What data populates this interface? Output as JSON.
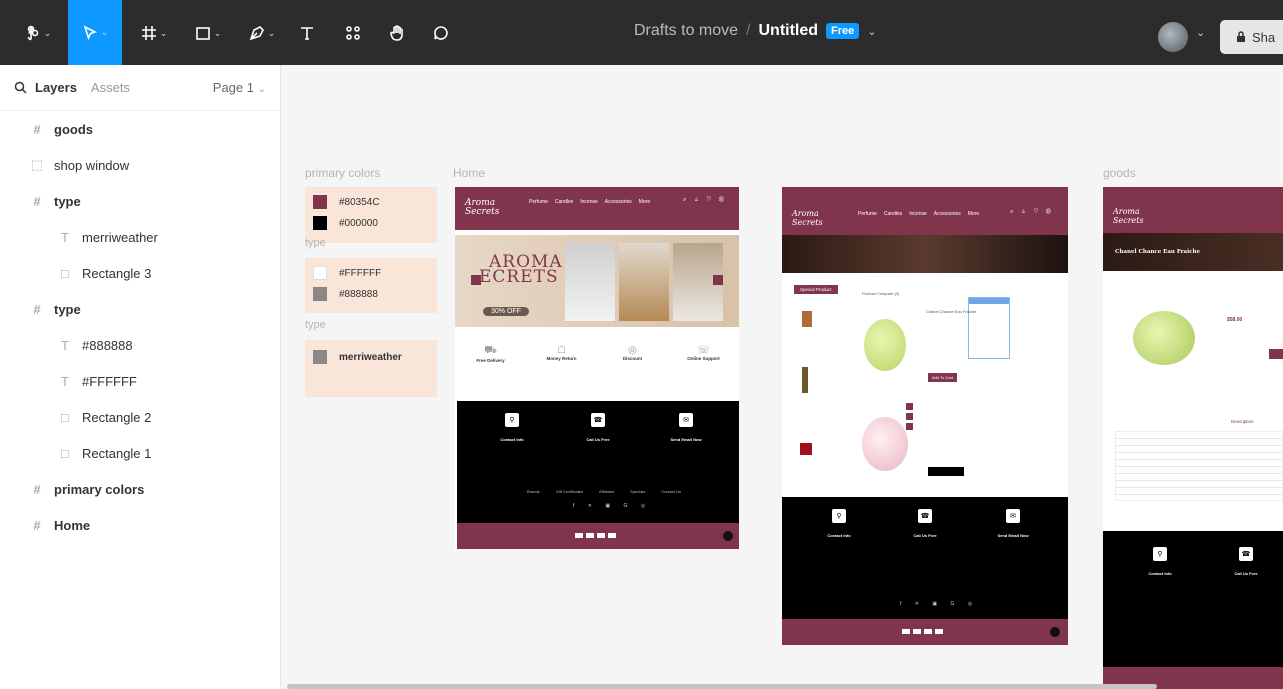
{
  "toolbar": {
    "tools": [
      {
        "name": "main-menu",
        "icon": "figma-logo-icon"
      },
      {
        "name": "move",
        "icon": "cursor-icon"
      },
      {
        "name": "frame",
        "icon": "frame-icon"
      },
      {
        "name": "shape",
        "icon": "rectangle-icon"
      },
      {
        "name": "pen",
        "icon": "pen-icon"
      },
      {
        "name": "text",
        "icon": "text-icon"
      },
      {
        "name": "resources",
        "icon": "resources-icon"
      },
      {
        "name": "hand",
        "icon": "hand-icon"
      },
      {
        "name": "comment",
        "icon": "comment-icon"
      }
    ],
    "breadcrumb_folder": "Drafts to move",
    "separator": "/",
    "file_name": "Untitled",
    "plan_badge": "Free",
    "share_label": "Sha"
  },
  "sidebar": {
    "tab_layers": "Layers",
    "tab_assets": "Assets",
    "page_selector": "Page 1",
    "layers": [
      {
        "label": "goods",
        "icon": "#",
        "child": false,
        "bold": true
      },
      {
        "label": "shop window",
        "icon": "⬚",
        "child": false,
        "bold": false
      },
      {
        "label": "type",
        "icon": "#",
        "child": false,
        "bold": true
      },
      {
        "label": "merriweather",
        "icon": "T",
        "child": true,
        "bold": false
      },
      {
        "label": "Rectangle 3",
        "icon": "□",
        "child": true,
        "bold": false
      },
      {
        "label": "type",
        "icon": "#",
        "child": false,
        "bold": true
      },
      {
        "label": "#888888",
        "icon": "T",
        "child": true,
        "bold": false
      },
      {
        "label": "#FFFFFF",
        "icon": "T",
        "child": true,
        "bold": false
      },
      {
        "label": "Rectangle 2",
        "icon": "□",
        "child": true,
        "bold": false
      },
      {
        "label": "Rectangle 1",
        "icon": "□",
        "child": true,
        "bold": false
      },
      {
        "label": "primary colors",
        "icon": "#",
        "child": false,
        "bold": true
      },
      {
        "label": "Home",
        "icon": "#",
        "child": false,
        "bold": true
      }
    ]
  },
  "canvas": {
    "frame_labels": {
      "primary_colors": "primary colors",
      "home": "Home",
      "goods": "goods",
      "type_1": "type",
      "type_2": "type"
    },
    "swatches": {
      "c1": {
        "hex": "#80354C",
        "color": "#80354c"
      },
      "c2": {
        "hex": "#000000",
        "color": "#000000"
      },
      "c3": {
        "hex": "#FFFFFF",
        "color": "#ffffff"
      },
      "c4": {
        "hex": "#888888",
        "color": "#888888"
      },
      "font": {
        "label": "merriweather",
        "color": "#888888"
      }
    },
    "home_frame": {
      "logo_line1": "Aroma",
      "logo_line2": "Secrets",
      "nav": [
        "Perfume",
        "Candles",
        "Incense",
        "Accessories",
        "More"
      ],
      "hero_line1": "AROMA",
      "hero_line2": "ECRETS",
      "hero_offer": "30% OFF",
      "features": [
        "Free Delivery",
        "Money Return",
        "Discount",
        "Online Support"
      ],
      "footer_cols": [
        "Contact Info",
        "Call Us Free",
        "Send Email Now"
      ],
      "footer_links": [
        "Brands",
        "Gift Certificates",
        "Affiliates",
        "Specials",
        "Contact Us"
      ]
    },
    "shop_frame": {
      "logo_line1": "Aroma",
      "logo_line2": "Secrets",
      "nav": [
        "Perfume",
        "Candles",
        "Incense",
        "Accessories",
        "More"
      ],
      "special_product": "Special Product",
      "compare": "Product Compare (0)",
      "product_1": "Chanel Chance Eau Fraiche",
      "add_to_cart": "Add To Cart",
      "footer_cols": [
        "Contact Info",
        "Call Us Free",
        "Send Email Now"
      ]
    },
    "goods_frame": {
      "logo_line1": "Aroma",
      "logo_line2": "Secrets",
      "product_title": "Chanel Chance Eau Fraiche",
      "price": "$58.00",
      "description": "Description",
      "footer_cols": [
        "Contact Info",
        "Call Us Free"
      ]
    }
  }
}
